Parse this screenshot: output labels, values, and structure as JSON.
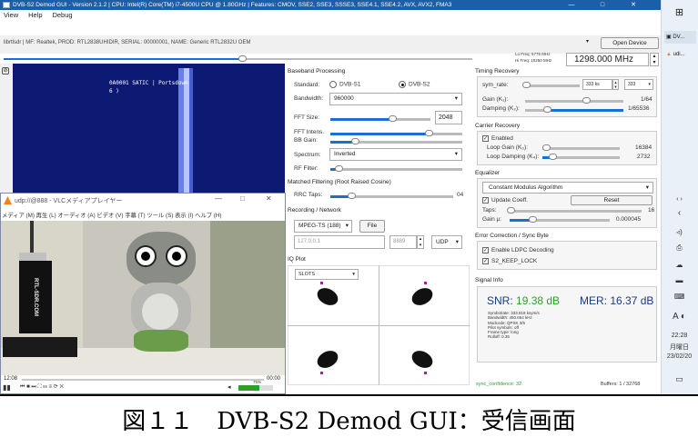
{
  "window": {
    "title": "DVB-S2 Demod GUI - Version 2.1.2 | CPU: Intel(R) Core(TM) i7-4500U CPU @ 1.80GHz | Features: CMOV, SSE2, SSE3, SSSE3, SSE4.1, SSE4.2, AVX, AVX2, FMA3",
    "minimize": "—",
    "maximize": "□",
    "close": "✕"
  },
  "menu": [
    "View",
    "Help",
    "Debug"
  ],
  "device": {
    "text": "librtlsdr | MF: Realtek, PROD: RTL2838UHIDIR, SERIAL: 00000001, NAME: Generic RTL2832U OEM",
    "open_label": "Open Device",
    "lo_freq": "Lo Freq: 5775 MHz",
    "hi_freq": "Hi Freq: 10250 MHz",
    "frequency": "1298.000 MHz"
  },
  "spectrum": {
    "overlay": "0A0001 SATIC | Portsdown",
    "overlay2": "6 )"
  },
  "baseband": {
    "title": "Baseband Processing",
    "standard_label": "Standard:",
    "opt1": "DVB-S1",
    "opt2": "DVB-S2",
    "bandwidth_label": "Bandwidth:",
    "bandwidth": "960000",
    "fft_label": "FFT Size:",
    "fft": "2048",
    "fft_intens": "FFT Intens.",
    "bb_gain": "BB Gain:",
    "spectrum_label": "Spectrum:",
    "spectrum": "Inverted",
    "rf_filter": "RF Filter:"
  },
  "matched": {
    "title": "Matched Filtering (Root Raised Cosine)",
    "rrc": "RRC Taps:",
    "rrc_val": "04"
  },
  "recording": {
    "title": "Recording / Network",
    "format": "MPEG-TS (188)",
    "file": "File",
    "ip": "127.0.0.1",
    "port": "8889",
    "proto": "UDP"
  },
  "iq": {
    "title": "IQ Plot",
    "select": "SLOTS"
  },
  "timing": {
    "title": "Timing Recovery",
    "sym_rate": "sym_rate:",
    "sym_val": "333 ks",
    "sym_val2": "333",
    "gain": "Gain (K₁):",
    "gain_val": "1/64",
    "damp": "Damping (K₂):",
    "damp_val": "1/65536"
  },
  "carrier": {
    "title": "Carrier Recovery",
    "enabled": "Enabled",
    "loop_gain": "Loop Gain (K₃):",
    "loop_gain_val": "16384",
    "loop_damp": "Loop Damping (K₄):",
    "loop_damp_val": "2732"
  },
  "equalizer": {
    "title": "Equalizer",
    "algo": "Constant Modulus Algorithm",
    "update": "Update Coeff.",
    "reset": "Reset",
    "taps": "Taps:",
    "taps_val": "16",
    "gain": "Gain μ:",
    "gain_val": "0.000045"
  },
  "errcorr": {
    "title": "Error Correction / Sync Byte",
    "ldpc": "Enable LDPC Decoding",
    "lock": "S2_KEEP_LOCK"
  },
  "signal": {
    "title": "Signal Info",
    "snr_label": "SNR:",
    "snr": "19.38 dB",
    "mer_label": "MER:",
    "mer": "16.37 dB",
    "l1": "Symbolrate: 333.818 ksym/s",
    "l2": "Bandwidth: 450.654 kHz",
    "l3": "Modcode: QPSK 3/5",
    "l4": "Pilot symbols: off",
    "l5": "Frame type: long",
    "l6": "Rolloff: 0.35",
    "sync": "sync_confidence: 32",
    "buffers": "Buffers: 1 / 32768"
  },
  "vlc": {
    "title": "udp://@888 - VLCメディアプレイヤー",
    "menu": "メディア (M)  再生 (L)  オーディオ (A)  ビデオ (V)  字幕 (T)  ツール (S)  表示 (I)  ヘルプ (H)",
    "time_left": "12:08",
    "time_right": "00:00",
    "volume": "75%",
    "dongle": "RTL-SDR.COM"
  },
  "taskbar": {
    "item1": "DV...",
    "item2": "udi...",
    "time": "22:28",
    "day": "月曜日",
    "date": "23/02/20",
    "lang": "A"
  },
  "caption": "図１１　DVB-S2 Demod GUI：受信画面"
}
